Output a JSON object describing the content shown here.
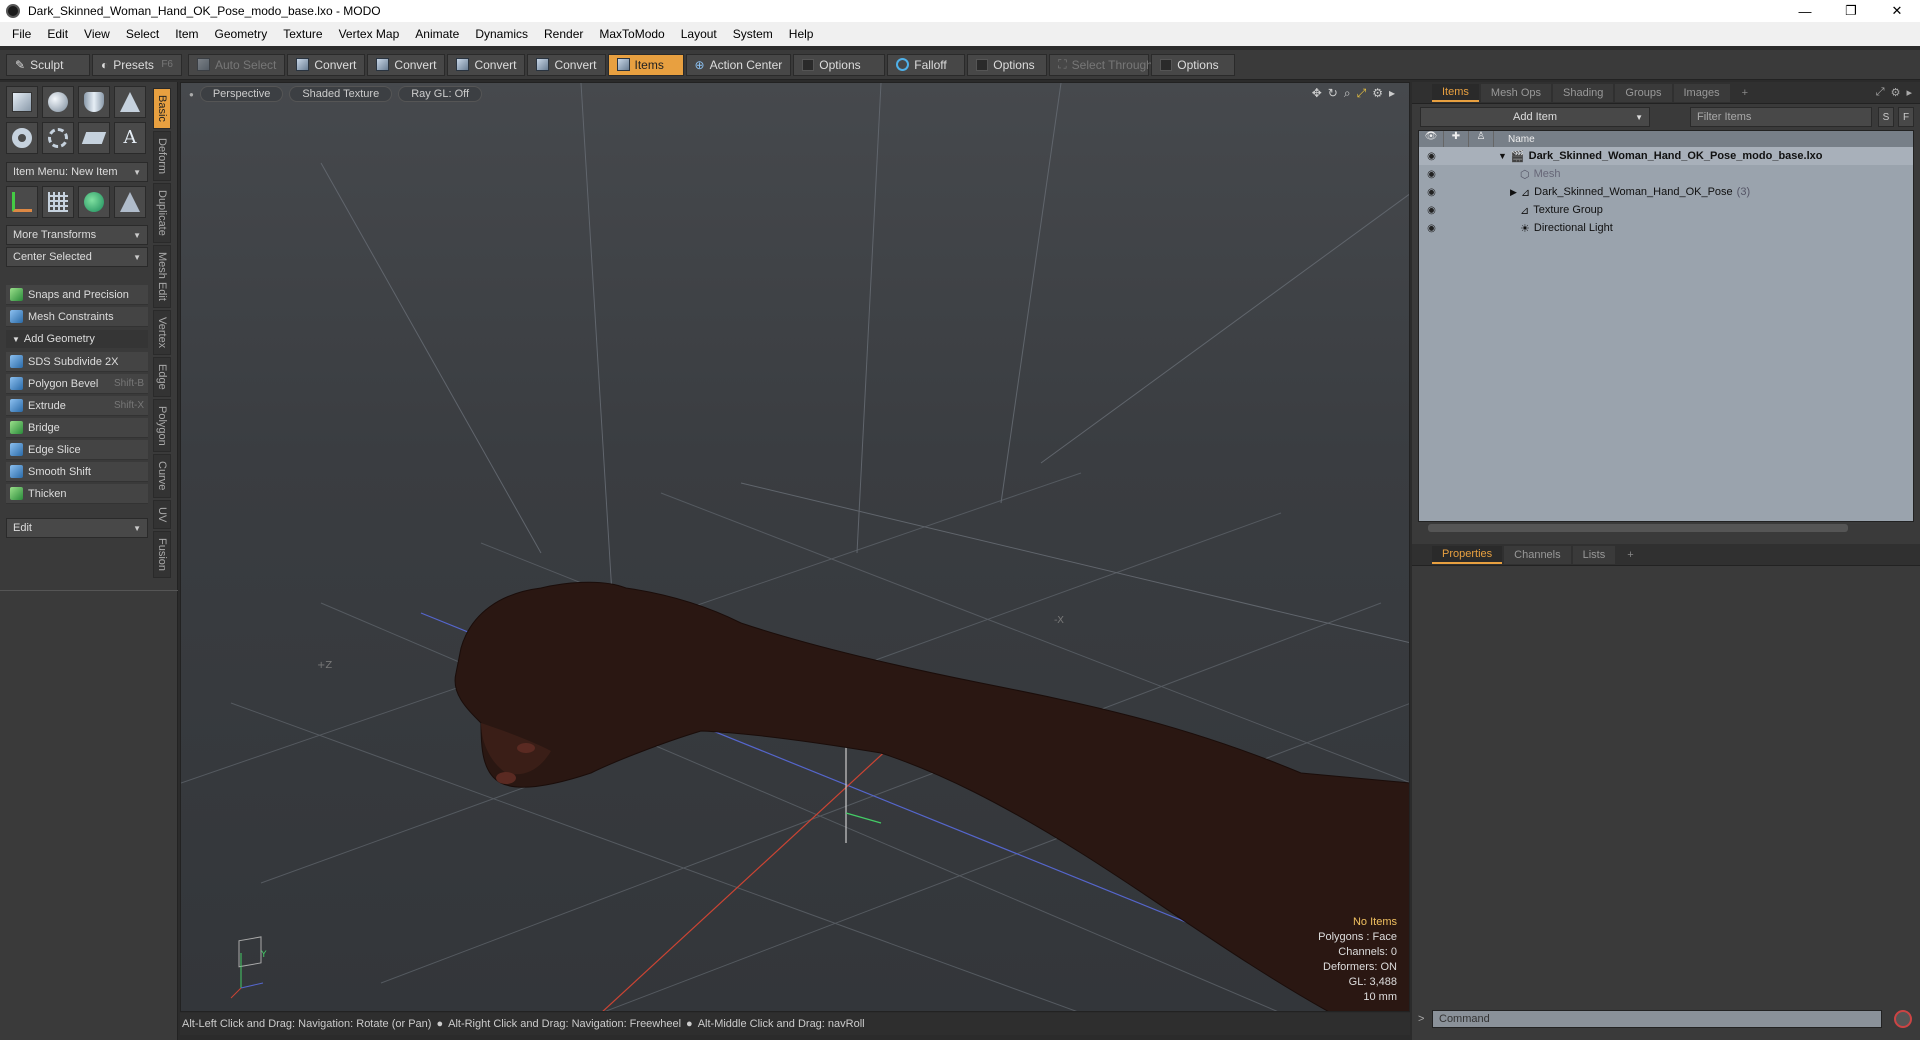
{
  "window": {
    "title": "Dark_Skinned_Woman_Hand_OK_Pose_modo_base.lxo - MODO",
    "controls": [
      "—",
      "❐",
      "✕"
    ]
  },
  "menu": [
    "File",
    "Edit",
    "View",
    "Select",
    "Item",
    "Geometry",
    "Texture",
    "Vertex Map",
    "Animate",
    "Dynamics",
    "Render",
    "MaxToModo",
    "Layout",
    "System",
    "Help"
  ],
  "toolbar": {
    "sculpt": "Sculpt",
    "presets": "Presets",
    "presets_key": "F6",
    "auto_select": "Auto Select",
    "convert1": "Convert",
    "convert2": "Convert",
    "convert3": "Convert",
    "convert4": "Convert",
    "items": "Items",
    "action_center": "Action Center",
    "options1": "Options",
    "falloff": "Falloff",
    "options2": "Options",
    "select_through": "Select Through",
    "options3": "Options"
  },
  "left": {
    "item_menu": "Item Menu: New Item",
    "more_transforms": "More Transforms",
    "center_selected": "Center Selected",
    "snaps": "Snaps and Precision",
    "mesh_constraints": "Mesh Constraints",
    "add_geometry": "Add Geometry",
    "tools": [
      {
        "label": "SDS Subdivide 2X",
        "key": ""
      },
      {
        "label": "Polygon Bevel",
        "key": "Shift-B"
      },
      {
        "label": "Extrude",
        "key": "Shift-X"
      },
      {
        "label": "Bridge",
        "key": ""
      },
      {
        "label": "Edge Slice",
        "key": ""
      },
      {
        "label": "Smooth Shift",
        "key": ""
      },
      {
        "label": "Thicken",
        "key": ""
      }
    ],
    "edit": "Edit",
    "side_tabs": [
      "Basic",
      "Deform",
      "Duplicate",
      "Mesh Edit",
      "Vertex",
      "Edge",
      "Polygon",
      "Curve",
      "UV",
      "Fusion"
    ]
  },
  "viewport": {
    "view": "Perspective",
    "shading": "Shaded Texture",
    "raygl": "Ray GL: Off",
    "axis_labels": {
      "z": "+Z",
      "x": "-X",
      "y": "Y"
    },
    "info": {
      "items": "No Items",
      "polygons": "Polygons : Face",
      "channels": "Channels: 0",
      "deformers": "Deformers: ON",
      "gl": "GL: 3,488",
      "unit": "10 mm"
    }
  },
  "status": {
    "hint1": "Alt-Left Click and Drag: Navigation: Rotate (or Pan)",
    "hint2": "Alt-Right Click and Drag: Navigation: Freewheel",
    "hint3": "Alt-Middle Click and Drag: navRoll"
  },
  "items_panel": {
    "tabs": [
      "Items",
      "Mesh Ops",
      "Shading",
      "Groups",
      "Images"
    ],
    "add_item": "Add Item",
    "filter_placeholder": "Filter Items",
    "s_btn": "S",
    "f_btn": "F",
    "name_header": "Name",
    "rows": [
      {
        "label": "Dark_Skinned_Woman_Hand_OK_Pose_modo_base.lxo",
        "count": ""
      },
      {
        "label": "Mesh",
        "count": ""
      },
      {
        "label": "Dark_Skinned_Woman_Hand_OK_Pose",
        "count": "(3)"
      },
      {
        "label": "Texture Group",
        "count": ""
      },
      {
        "label": "Directional Light",
        "count": ""
      }
    ]
  },
  "props_panel": {
    "tabs": [
      "Properties",
      "Channels",
      "Lists"
    ],
    "command_placeholder": "Command"
  }
}
